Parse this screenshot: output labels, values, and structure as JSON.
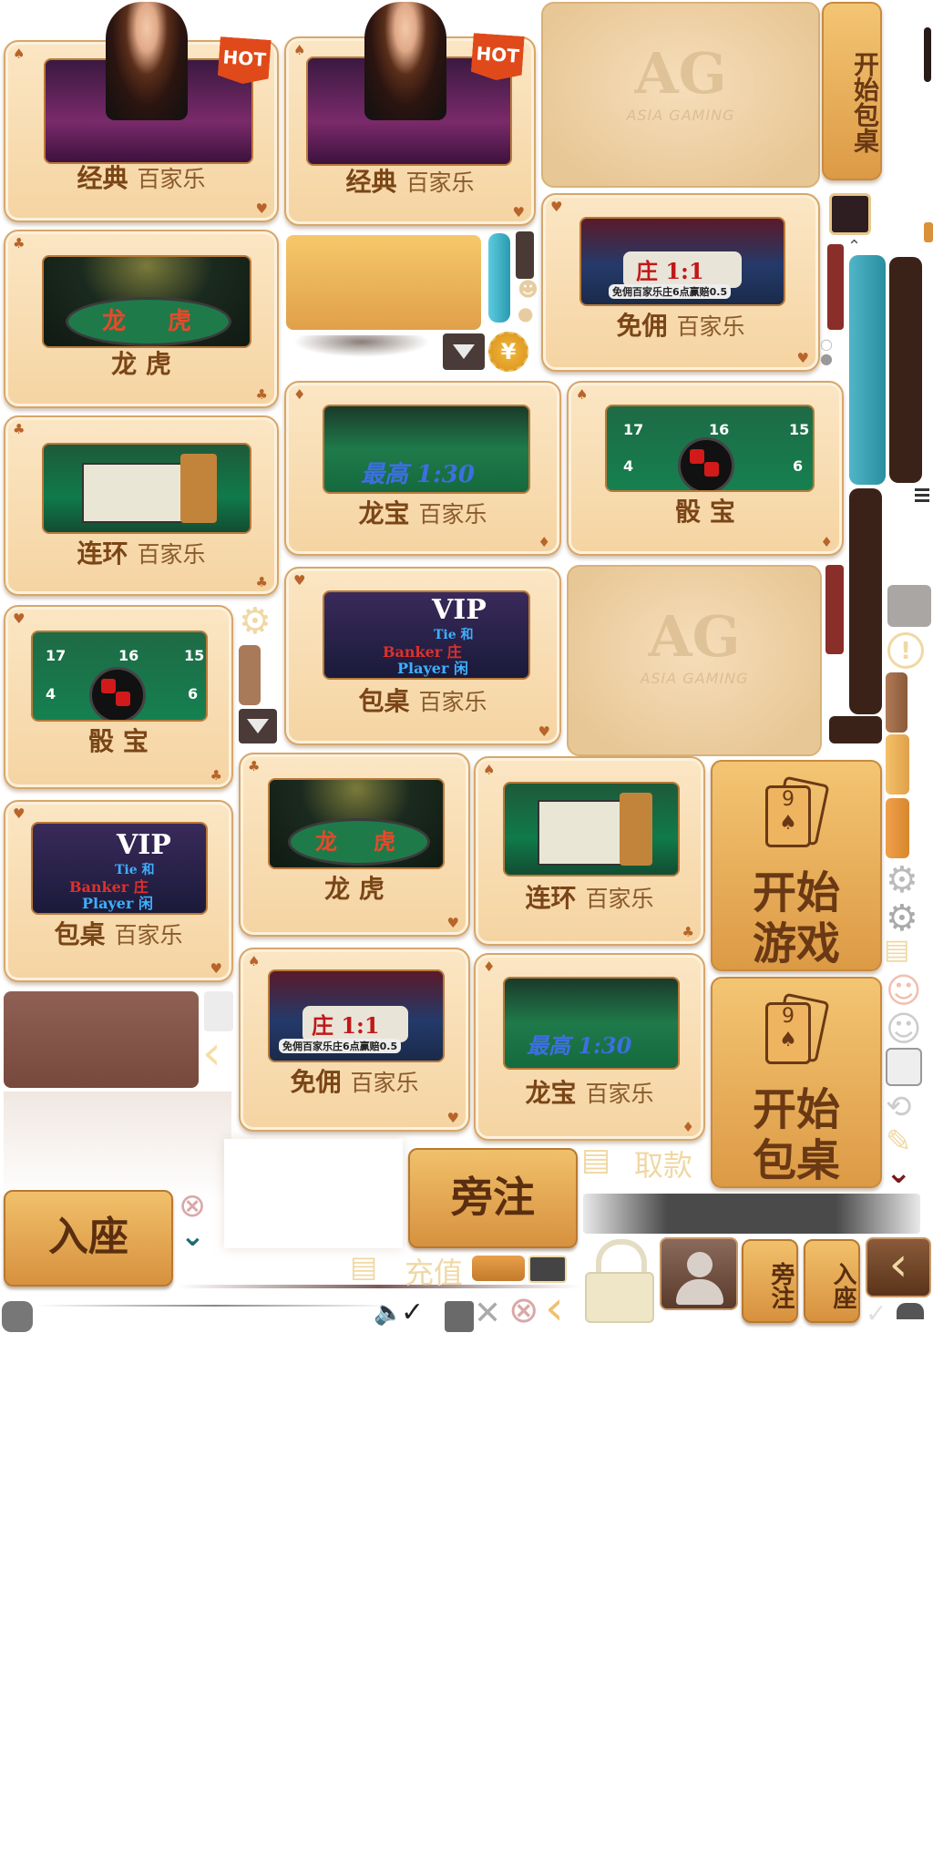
{
  "cards": {
    "classic1": {
      "bold": "经典",
      "name": "百家乐",
      "hot": "HOT"
    },
    "classic2": {
      "bold": "经典",
      "name": "百家乐",
      "hot": "HOT"
    },
    "nocommission1": {
      "bold": "免佣",
      "name": "百家乐",
      "thumb_big": "庄 1:1",
      "thumb_small": "免佣百家乐庄6点赢赔0.5"
    },
    "dragontiger1": {
      "bold": "龙  虎",
      "thumb_left": "龙",
      "thumb_right": "虎"
    },
    "dragonbonus1": {
      "bold": "龙宝",
      "name": "百家乐",
      "thumb_text": "最高 1:30"
    },
    "sicbo1": {
      "bold": "骰  宝",
      "nums": [
        "17",
        "16",
        "15",
        "4",
        "6"
      ]
    },
    "link1": {
      "bold": "连环",
      "name": "百家乐"
    },
    "sicbo2": {
      "bold": "骰  宝",
      "nums": [
        "17",
        "16",
        "15",
        "4",
        "6"
      ]
    },
    "private1": {
      "bold": "包桌",
      "name": "百家乐",
      "thumb_vip": "VIP",
      "thumb_tie": "Tie 和",
      "thumb_banker": "Banker 庄",
      "thumb_player": "Player 闲"
    },
    "private2": {
      "bold": "包桌",
      "name": "百家乐",
      "thumb_vip": "VIP",
      "thumb_tie": "Tie 和",
      "thumb_banker": "Banker 庄",
      "thumb_player": "Player 闲"
    },
    "dragontiger2": {
      "bold": "龙  虎",
      "thumb_left": "龙",
      "thumb_right": "虎"
    },
    "link2": {
      "bold": "连环",
      "name": "百家乐"
    },
    "nocommission2": {
      "bold": "免佣",
      "name": "百家乐",
      "thumb_big": "庄 1:1",
      "thumb_small": "免佣百家乐庄6点赢赔0.5"
    },
    "dragonbonus2": {
      "bold": "龙宝",
      "name": "百家乐",
      "thumb_text": "最高 1:30"
    }
  },
  "ag": {
    "logo": "AG",
    "sub": "ASIA GAMING"
  },
  "buttons": {
    "start_private_vertical": "开始包桌",
    "start_game_line1": "开始",
    "start_game_line2": "游戏",
    "start_private_line1": "开始",
    "start_private_line2": "包桌",
    "side_bet": "旁注",
    "sit": "入座",
    "withdraw": "取款",
    "deposit": "充值",
    "side_bet_small": "旁注",
    "sit_small": "入座"
  },
  "colors": {
    "accent": "#dd9a45",
    "card_bg": "#f5d4a2",
    "text_brown": "#6f3f17",
    "teal": "#3aa6b8"
  }
}
